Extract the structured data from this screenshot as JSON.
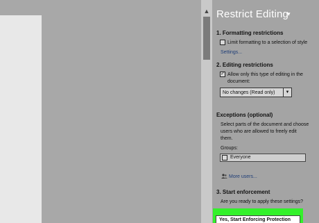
{
  "pane": {
    "title": "Restrict Editing",
    "menu_glyph": "▾"
  },
  "formatting": {
    "heading": "1. Formatting restrictions",
    "limit_label": "Limit formatting to a selection of style",
    "limit_checked": false,
    "settings_link": "Settings..."
  },
  "editing": {
    "heading": "2. Editing restrictions",
    "allow_line1": "Allow only this type of editing in the",
    "allow_line2": "document:",
    "allow_checked": true,
    "select_value": "No changes (Read only)"
  },
  "exceptions": {
    "heading": "Exceptions (optional)",
    "desc_line1": "Select parts of the document and choose",
    "desc_line2": "users who are allowed to freely edit",
    "desc_line3": "them.",
    "groups_label": "Groups:",
    "group_everyone": "Everyone",
    "more_users_link": "More users..."
  },
  "enforcement": {
    "heading": "3. Start enforcement",
    "question": "Are you ready to apply these settings?",
    "button_label": "Yes, Start Enforcing Protection",
    "highlight_color": "#33f12b"
  }
}
